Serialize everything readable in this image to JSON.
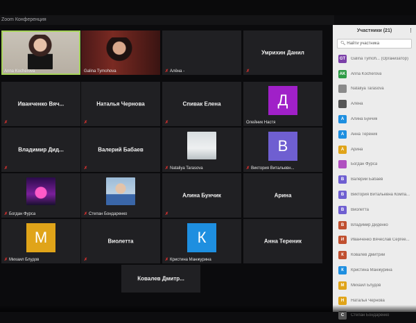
{
  "window": {
    "title": "Zoom Конференция"
  },
  "tiles": [
    {
      "name": "",
      "label": "Anna Kocherova",
      "muted": false,
      "kind": "video1"
    },
    {
      "name": "",
      "label": "Galina Tymohova",
      "muted": false,
      "kind": "video2"
    },
    {
      "name": "",
      "label": "Алёна -",
      "muted": true,
      "kind": "blank"
    },
    {
      "name": "Умрихин Данил",
      "label": "",
      "muted": true,
      "kind": "name"
    },
    {
      "name": "Иванченко Вяч...",
      "label": "",
      "muted": true,
      "kind": "name"
    },
    {
      "name": "Наталья Чернова",
      "label": "",
      "muted": true,
      "kind": "name"
    },
    {
      "name": "Спивак Елена",
      "label": "",
      "muted": true,
      "kind": "name"
    },
    {
      "name": "",
      "label": "Олейник Настя",
      "muted": false,
      "kind": "avatar",
      "letter": "Д",
      "color": "#a020c8"
    },
    {
      "name": "Владимир Дид...",
      "label": "",
      "muted": true,
      "kind": "name"
    },
    {
      "name": "Валерий Бабаев",
      "label": "",
      "muted": true,
      "kind": "name"
    },
    {
      "name": "",
      "label": "Nataliya Tarasova",
      "muted": true,
      "kind": "photo-snow"
    },
    {
      "name": "",
      "label": "Виктория Витальевн...",
      "muted": true,
      "kind": "avatar",
      "letter": "В",
      "color": "#6f5fd1"
    },
    {
      "name": "",
      "label": "Богдан Фурса",
      "muted": true,
      "kind": "photo-palm"
    },
    {
      "name": "",
      "label": "Степан Бондаренко",
      "muted": true,
      "kind": "photo-man"
    },
    {
      "name": "Алина Бунчик",
      "label": "",
      "muted": true,
      "kind": "name"
    },
    {
      "name": "Арина",
      "label": "",
      "muted": false,
      "kind": "name"
    },
    {
      "name": "",
      "label": "Михаил Блудов",
      "muted": true,
      "kind": "avatar",
      "letter": "М",
      "color": "#e0a419"
    },
    {
      "name": "Виолетта",
      "label": "",
      "muted": true,
      "kind": "name"
    },
    {
      "name": "",
      "label": "Кристина Манжурина",
      "muted": true,
      "kind": "avatar",
      "letter": "К",
      "color": "#1e8fe0"
    },
    {
      "name": "Анна Тереник",
      "label": "",
      "muted": false,
      "kind": "name"
    },
    {
      "name": "Ковалев Дмитр...",
      "label": "",
      "muted": false,
      "kind": "name"
    }
  ],
  "participants": {
    "title": "Участники (21)",
    "search_placeholder": "Найти участника",
    "items": [
      {
        "initials": "GT",
        "name": "Galina Tymoh... (Организатор)",
        "color": "#7b3fa8"
      },
      {
        "initials": "AK",
        "name": "Anna Kocherova",
        "color": "#2e9b46"
      },
      {
        "initials": "",
        "name": "Nataliya Tarasova",
        "color": "#8a8a8a"
      },
      {
        "initials": "",
        "name": "Алёна",
        "color": "#555555"
      },
      {
        "initials": "А",
        "name": "Алина Бунчик",
        "color": "#1e8fe0"
      },
      {
        "initials": "А",
        "name": "Анна Тереник",
        "color": "#1e8fe0"
      },
      {
        "initials": "А",
        "name": "Арина",
        "color": "#e0a419"
      },
      {
        "initials": "",
        "name": "Богдан Фурса",
        "color": "#b050c0"
      },
      {
        "initials": "В",
        "name": "Валерий Бабаев",
        "color": "#6f5fd1"
      },
      {
        "initials": "В",
        "name": "Виктория Витальевна Компа...",
        "color": "#6f5fd1"
      },
      {
        "initials": "В",
        "name": "Виолетта",
        "color": "#6f5fd1"
      },
      {
        "initials": "В",
        "name": "Владимир Диденко",
        "color": "#c05030"
      },
      {
        "initials": "И",
        "name": "Иванченко Вячеслав Сергее...",
        "color": "#c05030"
      },
      {
        "initials": "К",
        "name": "Ковалев Дмитрий",
        "color": "#c05030"
      },
      {
        "initials": "К",
        "name": "Кристина Манжурина",
        "color": "#1e8fe0"
      },
      {
        "initials": "М",
        "name": "Михаил Блудов",
        "color": "#e0a419"
      },
      {
        "initials": "Н",
        "name": "Наталья Чернова",
        "color": "#e0a419"
      },
      {
        "initials": "С",
        "name": "Степан Бондаренко",
        "color": "#555555"
      }
    ]
  }
}
